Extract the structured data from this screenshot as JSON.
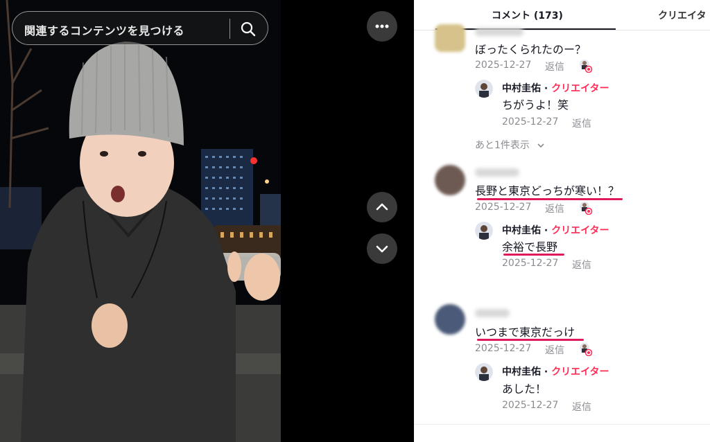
{
  "search": {
    "placeholder": "関連するコンテンツを見つける"
  },
  "tabs": [
    {
      "label": "コメント (173)"
    },
    {
      "label": "クリエイタ"
    }
  ],
  "comments": [
    {
      "text": "ぼったくられたのー？",
      "date": "2025-12-27",
      "reply_label": "返信",
      "creator_reply": {
        "name": "中村圭佑",
        "sep": " · ",
        "tag": "クリエイター",
        "text": "ちがうよ！笑",
        "date": "2025-12-27",
        "reply_label": "返信"
      },
      "more_replies": "あと1件表示"
    },
    {
      "text": "長野と東京どっちが寒い！？",
      "date": "2025-12-27",
      "reply_label": "返信",
      "creator_reply": {
        "name": "中村圭佑",
        "sep": " · ",
        "tag": "クリエイター",
        "text": "余裕で長野",
        "date": "2025-12-27",
        "reply_label": "返信"
      }
    },
    {
      "text": "いつまで東京だっけ",
      "date": "2025-12-27",
      "reply_label": "返信",
      "creator_reply": {
        "name": "中村圭佑",
        "sep": " · ",
        "tag": "クリエイター",
        "text": "あした！",
        "date": "2025-12-27",
        "reply_label": "返信"
      }
    }
  ],
  "colors": {
    "accent": "#fe2c55",
    "highlight": "#e0195a",
    "text": "#161823",
    "meta": "#8a8b91"
  }
}
